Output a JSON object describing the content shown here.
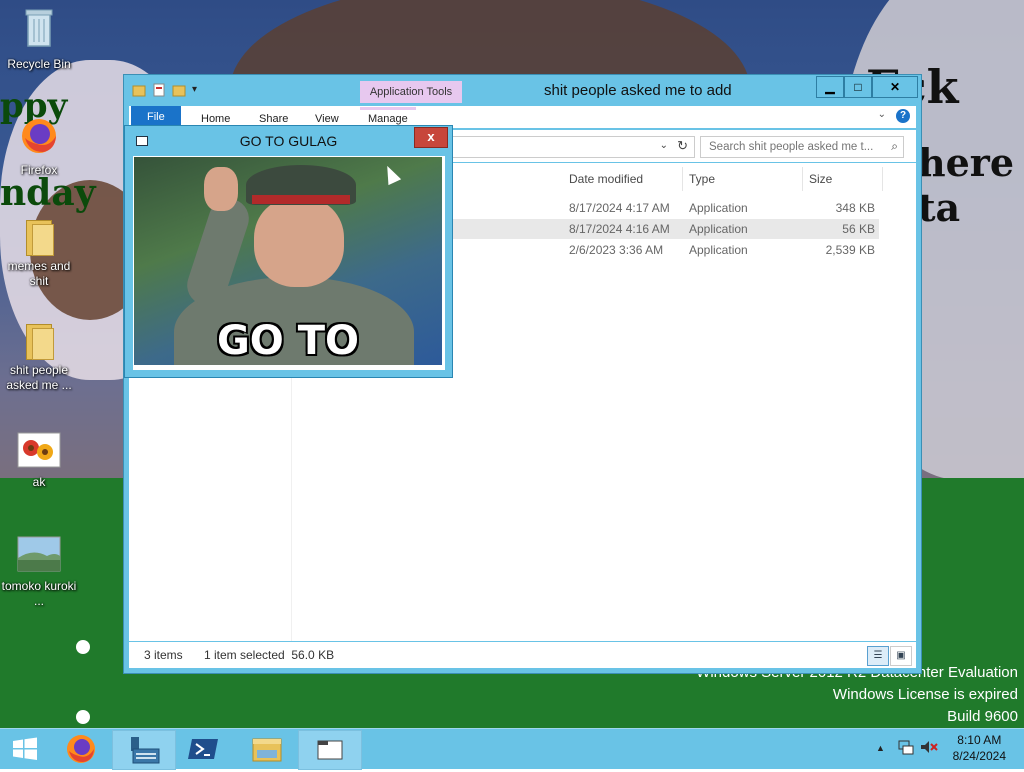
{
  "desktop": {
    "icons": [
      {
        "label": "Recycle Bin",
        "icon": "recycle-bin-icon"
      },
      {
        "label": "Firefox",
        "icon": "firefox-icon"
      },
      {
        "label": "memes and shit",
        "icon": "folder-icon"
      },
      {
        "label": "shit people asked me ...",
        "icon": "folder-icon"
      },
      {
        "label": "ak",
        "icon": "image-icon"
      },
      {
        "label": "tomoko kuroki ...",
        "icon": "image-icon"
      }
    ],
    "wallpaper_text_1": "Fck it,",
    "wallpaper_text_2": "here ta",
    "wallpaper_text_3": "ppy",
    "wallpaper_text_4": "nday",
    "watermark": {
      "line1": "Windows Server 2012 R2 Datacenter Evaluation",
      "line2": "Windows License is expired",
      "line3": "Build 9600"
    }
  },
  "explorer": {
    "title": "shit people asked me to add",
    "context_tab": "Application Tools",
    "ribbon_tabs": [
      "File",
      "Home",
      "Share",
      "View",
      "Manage"
    ],
    "search_placeholder": "Search shit people asked me t...",
    "columns": [
      "Date modified",
      "Type",
      "Size"
    ],
    "rows": [
      {
        "date": "8/17/2024 4:17 AM",
        "type": "Application",
        "size": "348 KB",
        "selected": false
      },
      {
        "date": "8/17/2024 4:16 AM",
        "type": "Application",
        "size": "56 KB",
        "selected": true
      },
      {
        "date": "2/6/2023 3:36 AM",
        "type": "Application",
        "size": "2,539 KB",
        "selected": false
      }
    ],
    "status_items": "3 items",
    "status_selected": "1 item selected  56.0 KB"
  },
  "viewer": {
    "title": "GO TO GULAG",
    "caption": "GO TO GULAG"
  },
  "taskbar": {
    "apps": [
      "start-button",
      "firefox",
      "server-manager",
      "powershell",
      "file-explorer",
      "explorer-window"
    ],
    "clock_time": "8:10 AM",
    "clock_date": "8/24/2024"
  },
  "colors": {
    "window_frame": "#69c3e6",
    "file_tab": "#1a73c9",
    "close_button": "#c7463b",
    "context_tab": "#e7c8ef",
    "wallpaper_grass": "#207a2b"
  }
}
